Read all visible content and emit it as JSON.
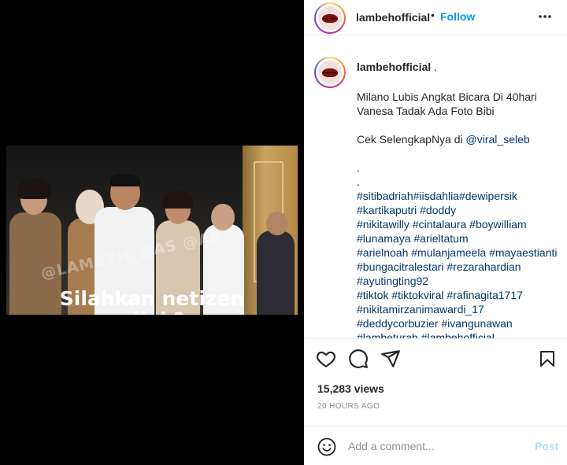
{
  "post": {
    "username": "lambehofficial",
    "follow_label": "Follow",
    "separator": "•",
    "more_icon": "more-horizontal-icon"
  },
  "video": {
    "watermark": "@LAMBEH_@AS @AS",
    "subtitle_line1": "Silahkan netizen",
    "subtitle_line2": "nilai ?"
  },
  "caption": {
    "username": "lambehofficial",
    "username_suffix": " .",
    "line1": "Milano Lubis Angkat Bicara Di 40hari",
    "line2": "Vanesa Tadak Ada Foto Bibi",
    "line3_prefix": "Cek SelengkapNya di ",
    "line3_link": "@viral_seleb",
    "dot1": ".",
    "dot2": ".",
    "hashtags": [
      "#sitibadriah#iisdahlia#dewipersik",
      "#kartikaputri #doddy",
      "#nikitawilly #cintalaura #boywilliam",
      "#lunamaya #arieltatum",
      "#arielnoah #mulanjameela #mayaestianti",
      "#bungacitralestari #rezarahardian",
      "#ayutingting92",
      "#tiktok #tiktokviral #rafinagita1717",
      "#nikitamirzanimawardi_17",
      "#deddycorbuzier #ivangunawan",
      "#lambeturah #lambehofficial"
    ]
  },
  "stats": {
    "views": "15,283 views",
    "time": "20 HOURS AGO"
  },
  "comment": {
    "placeholder": "Add a comment...",
    "post_label": "Post"
  },
  "colors": {
    "accent": "#0095f6",
    "link": "#00376b",
    "muted": "#8e8e8e",
    "post_disabled": "#b2dffc"
  }
}
